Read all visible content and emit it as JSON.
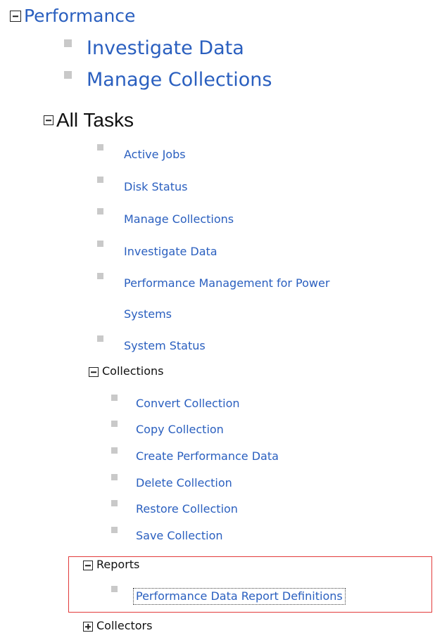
{
  "tree": {
    "root": {
      "label": "Performance",
      "items": [
        "Investigate Data",
        "Manage Collections"
      ]
    },
    "all_tasks": {
      "label": "All Tasks",
      "items": [
        "Active Jobs",
        "Disk Status",
        "Manage Collections",
        "Investigate Data",
        "Performance Management for Power",
        "Systems",
        "System Status"
      ]
    },
    "collections": {
      "label": "Collections",
      "items": [
        "Convert Collection",
        "Copy Collection",
        "Create Performance Data",
        "Delete Collection",
        "Restore Collection",
        "Save Collection"
      ]
    },
    "reports": {
      "label": "Reports",
      "items": [
        "Performance Data Report Definitions"
      ]
    },
    "collectors": {
      "label": "Collectors"
    }
  },
  "icons": {
    "expanded": "minus-box-icon",
    "collapsed": "plus-box-icon",
    "leaf": "square-bullet-icon"
  },
  "colors": {
    "link": "#2a5fbf",
    "highlight_border": "#e23b3b",
    "bullet": "#c9c9c9"
  }
}
